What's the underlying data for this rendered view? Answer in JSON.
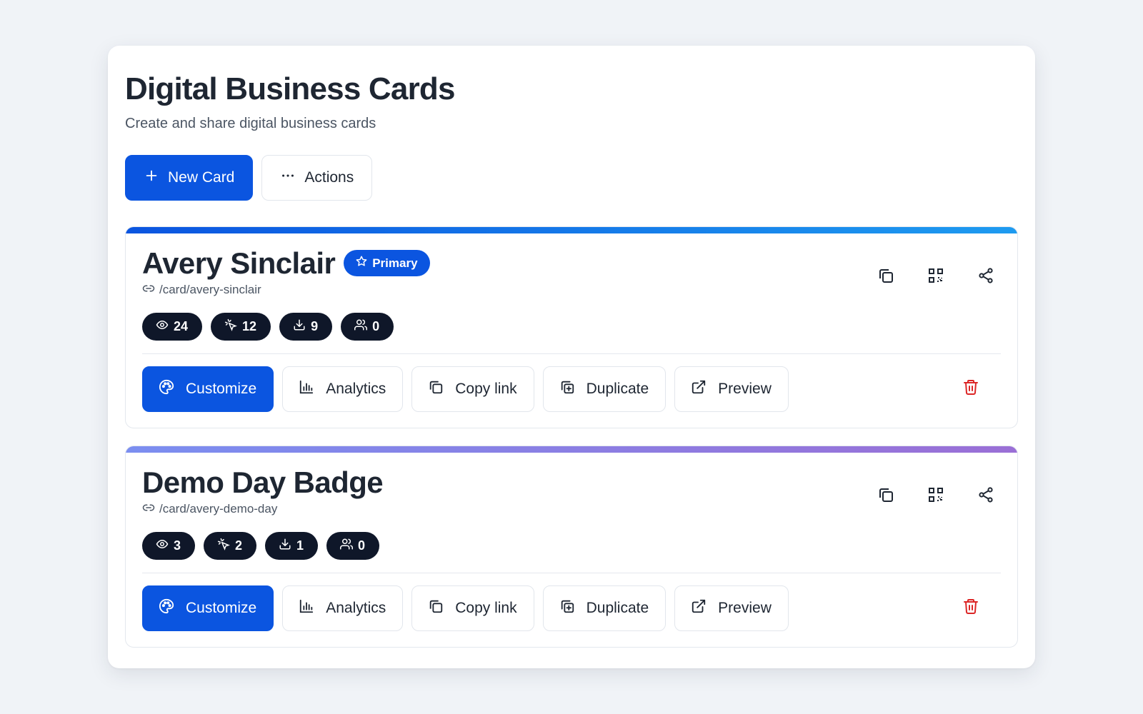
{
  "header": {
    "title": "Digital Business Cards",
    "subtitle": "Create and share digital business cards"
  },
  "toolbar": {
    "new_card_label": "New Card",
    "actions_label": "Actions"
  },
  "colors": {
    "primary": "#0b55e0",
    "stat_pill": "#0f1729",
    "danger": "#dc2626",
    "card1_accent": [
      "#0b55e0",
      "#1e9bf0"
    ],
    "card2_accent": [
      "#7b8ef0",
      "#9a6fd6"
    ]
  },
  "cards": [
    {
      "name": "Avery Sinclair",
      "badge": "Primary",
      "path": "/card/avery-sinclair",
      "stats": {
        "views": "24",
        "clicks": "12",
        "downloads": "9",
        "contacts": "0"
      },
      "actions": {
        "customize": "Customize",
        "analytics": "Analytics",
        "copy_link": "Copy link",
        "duplicate": "Duplicate",
        "preview": "Preview"
      }
    },
    {
      "name": "Demo Day Badge",
      "badge": "",
      "path": "/card/avery-demo-day",
      "stats": {
        "views": "3",
        "clicks": "2",
        "downloads": "1",
        "contacts": "0"
      },
      "actions": {
        "customize": "Customize",
        "analytics": "Analytics",
        "copy_link": "Copy link",
        "duplicate": "Duplicate",
        "preview": "Preview"
      }
    }
  ]
}
